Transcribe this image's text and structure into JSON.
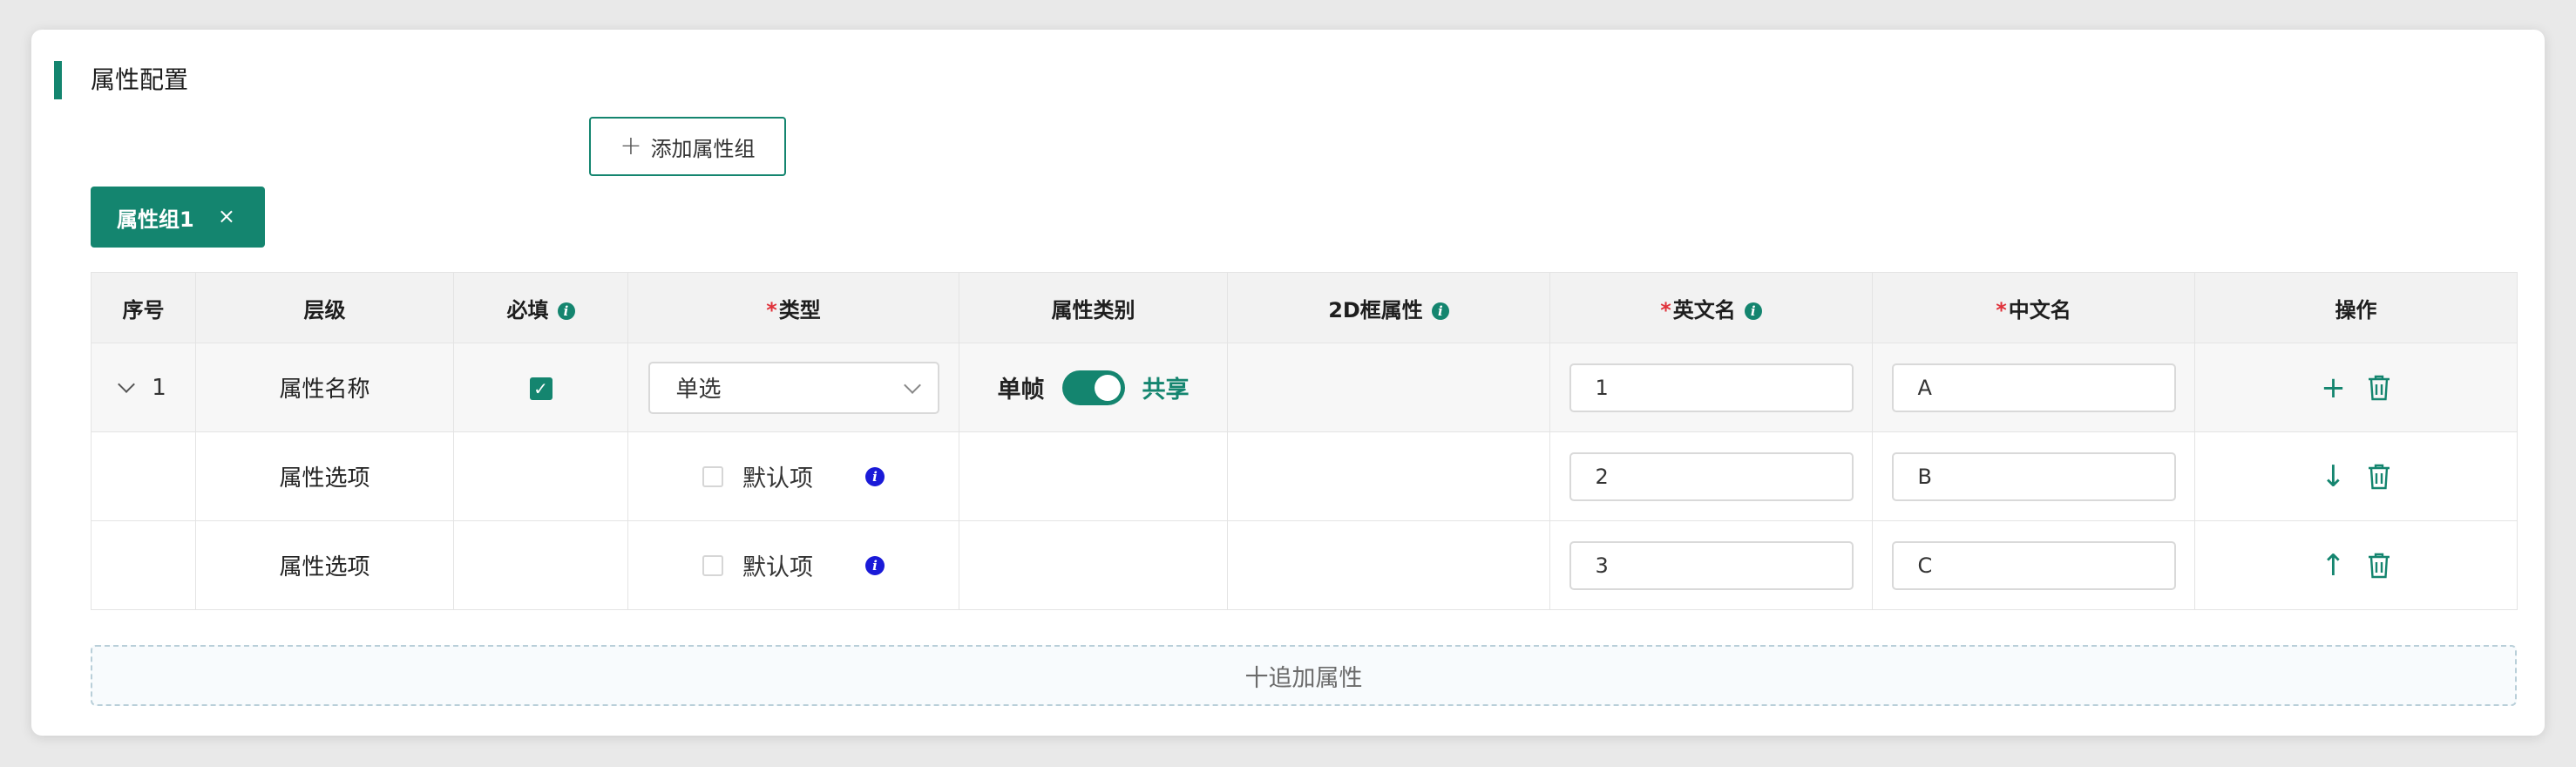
{
  "section": {
    "title": "属性配置"
  },
  "toolbar": {
    "add_group_label": "添加属性组",
    "add_group_icon": "plus-icon"
  },
  "group_tab": {
    "label": "属性组1",
    "close_glyph": "×"
  },
  "table": {
    "headers": {
      "index": "序号",
      "level": "层级",
      "required": "必填",
      "type": "类型",
      "category": "属性类别",
      "box2d": "2D框属性",
      "en_name": "英文名",
      "cn_name": "中文名",
      "actions": "操作"
    },
    "required_mark": "*",
    "info_glyph": "i",
    "rows": [
      {
        "index": "1",
        "level": "属性名称",
        "required_checked": true,
        "type_value": "单选",
        "category_left": "单帧",
        "category_right": "共享",
        "en_value": "1",
        "cn_value": "A"
      },
      {
        "level": "属性选项",
        "default_label": "默认项",
        "en_value": "2",
        "cn_value": "B",
        "move_icon": "arrow-down-icon"
      },
      {
        "level": "属性选项",
        "default_label": "默认项",
        "en_value": "3",
        "cn_value": "C",
        "move_icon": "arrow-up-icon"
      }
    ],
    "glyphs": {
      "plus": "+",
      "arrow_down": "↓",
      "arrow_up": "↑",
      "check": "✓"
    }
  },
  "footer": {
    "add_attr_label": "十追加属性"
  },
  "colors": {
    "accent": "#14856f",
    "required": "#e0323b",
    "info_blue": "#1a1ad8"
  }
}
